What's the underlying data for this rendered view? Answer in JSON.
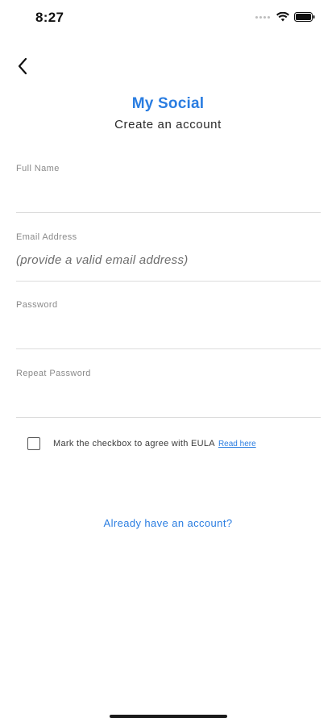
{
  "status_bar": {
    "time": "8:27",
    "icons": [
      "signal-dots-icon",
      "wifi-icon",
      "battery-icon"
    ]
  },
  "nav": {
    "back_icon": "chevron-left-icon"
  },
  "header": {
    "title": "My Social",
    "subtitle": "Create an account"
  },
  "form": {
    "full_name": {
      "label": "Full Name",
      "value": "",
      "placeholder": ""
    },
    "email": {
      "label": "Email Address",
      "value": "",
      "placeholder": "(provide a valid email address)"
    },
    "password": {
      "label": "Password",
      "value": "",
      "placeholder": ""
    },
    "repeat_password": {
      "label": "Repeat Password",
      "value": "",
      "placeholder": ""
    }
  },
  "eula": {
    "checked": false,
    "text": "Mark the checkbox to agree with EULA",
    "link_label": "Read here"
  },
  "login_link": "Already have an account?",
  "colors": {
    "accent": "#2a7de1",
    "divider": "#dcdcdc",
    "label": "#8a8a8a"
  }
}
